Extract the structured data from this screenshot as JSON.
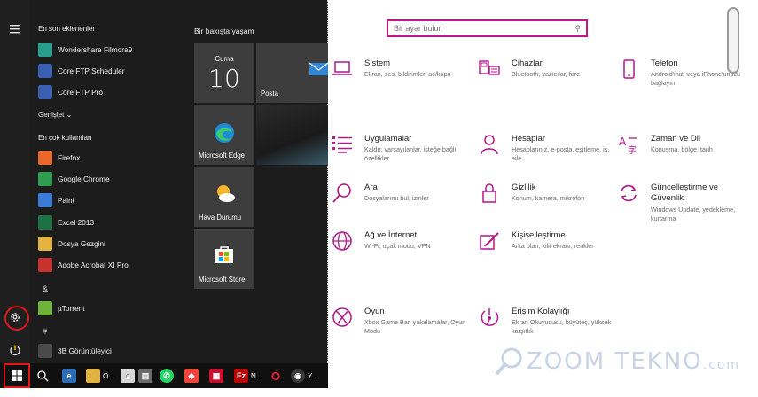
{
  "start": {
    "recent_label": "En son eklenenler",
    "recent": [
      {
        "label": "Wondershare Filmora9",
        "icon": "filmora-icon",
        "color": "#2a9e8e"
      },
      {
        "label": "Core FTP Scheduler",
        "icon": "coreftp-icon",
        "color": "#3a5fb0"
      },
      {
        "label": "Core FTP Pro",
        "icon": "coreftp-icon",
        "color": "#3a5fb0"
      }
    ],
    "expand_label": "Genişlet",
    "most_used_label": "En çok kullanılan",
    "most_used": [
      {
        "label": "Firefox",
        "icon": "firefox-icon",
        "color": "#e8672a"
      },
      {
        "label": "Google Chrome",
        "icon": "chrome-icon",
        "color": "#2f9d4f"
      },
      {
        "label": "Paint",
        "icon": "paint-icon",
        "color": "#3b7bd8"
      },
      {
        "label": "Excel 2013",
        "icon": "excel-icon",
        "color": "#1e7145"
      },
      {
        "label": "Dosya Gezgini",
        "icon": "folder-icon",
        "color": "#e3b341"
      },
      {
        "label": "Adobe Acrobat XI Pro",
        "icon": "acrobat-icon",
        "color": "#c9312c"
      }
    ],
    "alpha_amp": "&",
    "alpha_apps": [
      {
        "label": "µTorrent",
        "icon": "utorrent-icon",
        "color": "#6fb33a"
      }
    ],
    "alpha_hash": "#",
    "alpha_apps2": [
      {
        "label": "3B Görüntüleyici",
        "icon": "3d-viewer-icon",
        "color": "#4a4a4a"
      }
    ],
    "tiles_header": "Bir bakışta yaşam",
    "tiles": {
      "calendar_day": "Cuma",
      "calendar_num": "10",
      "mail": "Posta",
      "edge": "Microsoft Edge",
      "weather": "Hava Durumu",
      "store": "Microsoft Store"
    }
  },
  "taskbar": {
    "items": [
      {
        "label": "O...",
        "icon": "file-explorer-icon"
      },
      {
        "label": "Y...",
        "icon": "chrome-icon"
      },
      {
        "label": "N...",
        "icon": "filezilla-icon"
      }
    ]
  },
  "settings": {
    "search_placeholder": "Bir ayar bulun",
    "categories": [
      {
        "key": "system",
        "title": "Sistem",
        "desc": "Ekran, ses, bildirimler, aç/kapa",
        "icon": "laptop-icon"
      },
      {
        "key": "devices",
        "title": "Cihazlar",
        "desc": "Bluetooth, yazıcılar, fare",
        "icon": "keyboard-icon"
      },
      {
        "key": "phone",
        "title": "Telefon",
        "desc": "Android'inizi veya iPhone'unuzu bağlayın",
        "icon": "phone-icon"
      },
      {
        "key": "apps",
        "title": "Uygulamalar",
        "desc": "Kaldır, varsayılanlar, isteğe bağlı özellikler",
        "icon": "apps-list-icon"
      },
      {
        "key": "accounts",
        "title": "Hesaplar",
        "desc": "Hesaplarınız, e-posta, eşitleme, iş, aile",
        "icon": "person-icon"
      },
      {
        "key": "time",
        "title": "Zaman ve Dil",
        "desc": "Konuşma, bölge, tarih",
        "icon": "language-icon"
      },
      {
        "key": "search",
        "title": "Ara",
        "desc": "Dosyalarımı bul, izinler",
        "icon": "search-icon"
      },
      {
        "key": "privacy",
        "title": "Gizlilik",
        "desc": "Konum, kamera, mikrofon",
        "icon": "lock-icon"
      },
      {
        "key": "update",
        "title": "Güncelleştirme ve Güvenlik",
        "desc": "Windows Update, yedekleme, kurtarma",
        "icon": "sync-icon"
      },
      {
        "key": "network",
        "title": "Ağ ve İnternet",
        "desc": "Wi-Fi, uçak modu, VPN",
        "icon": "globe-icon"
      },
      {
        "key": "personalization",
        "title": "Kişiselleştirme",
        "desc": "Arka plan, kilit ekranı, renkler",
        "icon": "brush-icon"
      },
      {
        "key": "gaming",
        "title": "Oyun",
        "desc": "Xbox Game Bar, yakalamalar, Oyun Modu",
        "icon": "xbox-icon"
      },
      {
        "key": "ease",
        "title": "Erişim Kolaylığı",
        "desc": "Ekran Okuyucusu, büyüteç, yüksek karşıtlık",
        "icon": "ease-of-access-icon"
      }
    ],
    "accent": "#b4178b"
  },
  "watermark": "ZOOM TEKNO",
  "watermark_suffix": ".com"
}
